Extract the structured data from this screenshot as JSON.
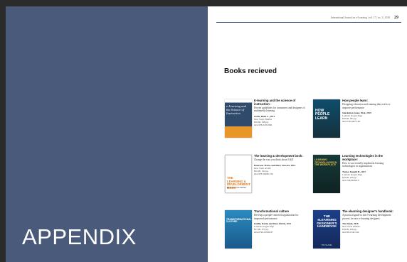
{
  "appendix_label": "APPENDIX",
  "page": {
    "journal": "International Journal on e-Learning | vol. 17 | iss. 3 | 2018",
    "page_number": "29",
    "section_title": "Books recieved"
  },
  "books": [
    {
      "cover_title": "e-Learning and the Science of Instruction",
      "title": "E-learning and the science of instruction:",
      "subtitle": "Proven guidelines for consumers and designers of multimedia learning",
      "author": "Clark, Ruth C., 2011",
      "place": "New York: Pfeiffer",
      "price": "$50.00, 528 pp.",
      "isbn": "isbn 978-0470-869"
    },
    {
      "cover_title": "HOW PEOPLE LEARN",
      "title": "How people learn:",
      "subtitle": "Designing education and training that works to improve performance",
      "author": "Shackleton Jones, Nick, 2019",
      "place": "London: Kogan Page",
      "price": "$35.00, 387 pp.",
      "isbn": "isbn 0749-8675-96"
    },
    {
      "cover_title": "THE LEARNING & DEVELOPMENT BOOK",
      "cover_sub": "Emerson, Trica Stewart",
      "title": "The learning & development book:",
      "subtitle": "Change the way you think about L&D",
      "author": "Emerson, Tricia, and Mary Stewart, 2013",
      "place": "New York: ASTD",
      "price": "$35.00, 192 pp.",
      "isbn": "isbn 978-56286-726"
    },
    {
      "cover_title": "LEARNING TECHNOLOGIES IN THE WORKPLACE",
      "title": "Learning technologies in the workplace:",
      "subtitle": "How to successfully implement learning technologies in organizations",
      "author": "Taylor, Donald H., 2017",
      "place": "London: Kogan Page",
      "price": "$35.00, 256 pp.",
      "isbn": "isbn 749-98-8210"
    },
    {
      "cover_title": "TRANSFORMATIONAL CULTURE",
      "title": "Transformational culture",
      "subtitle": "Develop a people-centered organization for improved performance",
      "author": "Liddle, David, and Dave Ulrich, 2021",
      "place": "London: Kogan Page",
      "price": "$17.00, 272 pp.",
      "isbn": "isbn 0749-10929-87"
    },
    {
      "cover_title": "THE eLEARNING DESIGNER'S HANDBOOK",
      "cover_sub": "TIM SLADE",
      "title": "The elearning designer's handbook:",
      "subtitle": "A practical guide to the e-learning development process for new e-learning designers",
      "author": "Tim Slade, 2018",
      "place": "New York: Pfeiffer",
      "price": "$16.99, 236 pp.",
      "isbn": "isbn 98-1342-542"
    }
  ]
}
